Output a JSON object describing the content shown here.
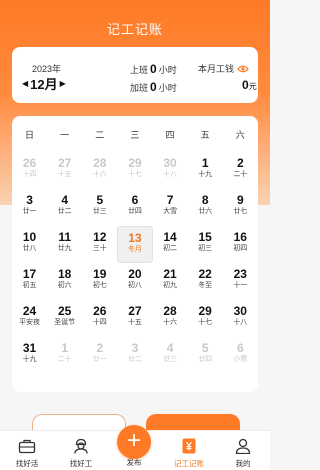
{
  "header": {
    "title": "记工记账"
  },
  "summary": {
    "year": "2023年",
    "month": "12月",
    "overtime_prefix": "上班",
    "overtime_value": "0",
    "overtime_unit": "小时",
    "extra_prefix": "加班",
    "extra_value": "0",
    "extra_unit": "小时",
    "wage_label": "本月工钱",
    "wage_value": "0",
    "wage_unit": "元"
  },
  "calendar": {
    "weekdays": [
      "日",
      "一",
      "二",
      "三",
      "四",
      "五",
      "六"
    ],
    "rows": [
      [
        {
          "d": "26",
          "l": "十四",
          "f": true
        },
        {
          "d": "27",
          "l": "十五",
          "f": true
        },
        {
          "d": "28",
          "l": "十六",
          "f": true
        },
        {
          "d": "29",
          "l": "十七",
          "f": true
        },
        {
          "d": "30",
          "l": "十八",
          "f": true
        },
        {
          "d": "1",
          "l": "十九",
          "f": false
        },
        {
          "d": "2",
          "l": "二十",
          "f": false
        }
      ],
      [
        {
          "d": "3",
          "l": "廿一",
          "f": false
        },
        {
          "d": "4",
          "l": "廿二",
          "f": false
        },
        {
          "d": "5",
          "l": "廿三",
          "f": false
        },
        {
          "d": "6",
          "l": "廿四",
          "f": false
        },
        {
          "d": "7",
          "l": "大雪",
          "f": false
        },
        {
          "d": "8",
          "l": "廿六",
          "f": false
        },
        {
          "d": "9",
          "l": "廿七",
          "f": false
        }
      ],
      [
        {
          "d": "10",
          "l": "廿八",
          "f": false
        },
        {
          "d": "11",
          "l": "廿九",
          "f": false
        },
        {
          "d": "12",
          "l": "三十",
          "f": false
        },
        {
          "d": "13",
          "l": "冬月",
          "f": false,
          "today": true
        },
        {
          "d": "14",
          "l": "初二",
          "f": false
        },
        {
          "d": "15",
          "l": "初三",
          "f": false
        },
        {
          "d": "16",
          "l": "初四",
          "f": false
        }
      ],
      [
        {
          "d": "17",
          "l": "初五",
          "f": false
        },
        {
          "d": "18",
          "l": "初六",
          "f": false
        },
        {
          "d": "19",
          "l": "初七",
          "f": false
        },
        {
          "d": "20",
          "l": "初八",
          "f": false
        },
        {
          "d": "21",
          "l": "初九",
          "f": false
        },
        {
          "d": "22",
          "l": "冬至",
          "f": false
        },
        {
          "d": "23",
          "l": "十一",
          "f": false
        }
      ],
      [
        {
          "d": "24",
          "l": "平安夜",
          "f": false
        },
        {
          "d": "25",
          "l": "圣诞节",
          "f": false
        },
        {
          "d": "26",
          "l": "十四",
          "f": false
        },
        {
          "d": "27",
          "l": "十五",
          "f": false
        },
        {
          "d": "28",
          "l": "十六",
          "f": false
        },
        {
          "d": "29",
          "l": "十七",
          "f": false
        },
        {
          "d": "30",
          "l": "十八",
          "f": false
        }
      ],
      [
        {
          "d": "31",
          "l": "十九",
          "f": false
        },
        {
          "d": "1",
          "l": "二十",
          "f": true
        },
        {
          "d": "2",
          "l": "廿一",
          "f": true
        },
        {
          "d": "3",
          "l": "廿二",
          "f": true
        },
        {
          "d": "4",
          "l": "廿三",
          "f": true
        },
        {
          "d": "5",
          "l": "廿四",
          "f": true
        },
        {
          "d": "6",
          "l": "小寒",
          "f": true
        }
      ]
    ]
  },
  "tabs": [
    {
      "label": "找好活",
      "icon": "briefcase-icon"
    },
    {
      "label": "找好工",
      "icon": "worker-icon"
    },
    {
      "label": "发布",
      "icon": "plus-icon"
    },
    {
      "label": "记工记账",
      "icon": "yen-ledger-icon",
      "active": true
    },
    {
      "label": "我的",
      "icon": "user-icon"
    }
  ],
  "colors": {
    "accent": "#ff7a26",
    "accent_text": "#f07a20"
  }
}
